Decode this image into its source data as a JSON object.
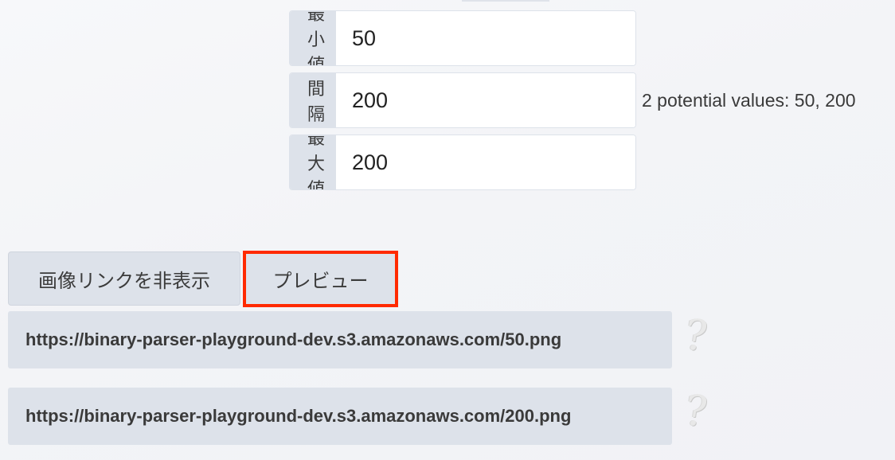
{
  "range": {
    "rows": [
      {
        "label": "最小値",
        "value": "50"
      },
      {
        "label": "間隔",
        "value": "200"
      },
      {
        "label": "最大値",
        "value": "200"
      }
    ],
    "potential_values_text": "2 potential values: 50, 200"
  },
  "buttons": {
    "hide_image_links": "画像リンクを非表示",
    "preview": "プレビュー"
  },
  "links": [
    {
      "url": "https://binary-parser-playground-dev.s3.amazonaws.com/50.png",
      "preview_icon": "?"
    },
    {
      "url": "https://binary-parser-playground-dev.s3.amazonaws.com/200.png",
      "preview_icon": "?"
    }
  ],
  "colors": {
    "highlight": "#ff2a00",
    "label_background": "#dde2ea"
  }
}
